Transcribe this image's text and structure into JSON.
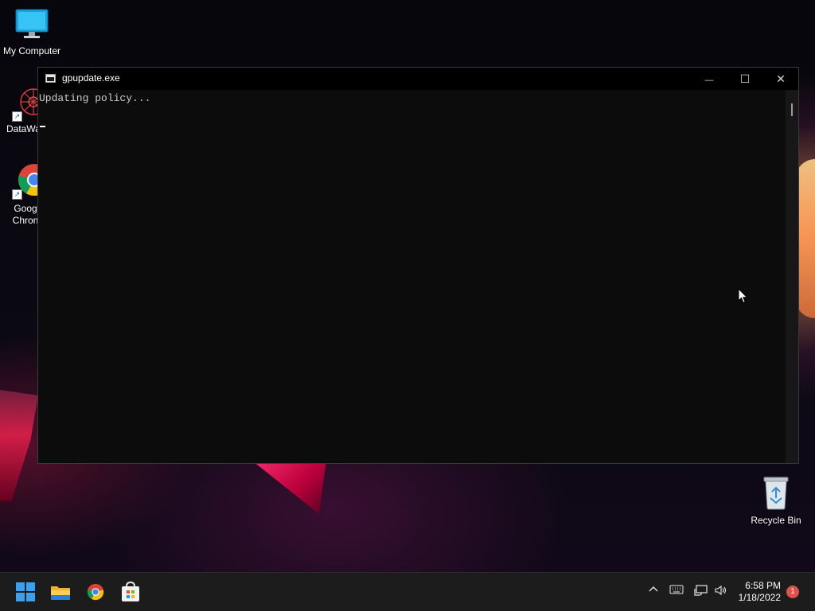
{
  "desktop": {
    "icons": [
      {
        "label": "My Computer"
      },
      {
        "label": "DataWag"
      },
      {
        "label": "Goog Chron"
      }
    ],
    "recycle_bin_label": "Recycle Bin"
  },
  "window": {
    "title": "gpupdate.exe",
    "output_line": "Updating policy...",
    "minimize_glyph": "—",
    "maximize_glyph": "☐",
    "close_glyph": "✕"
  },
  "taskbar": {
    "apps": [
      "start-icon",
      "file-explorer-icon",
      "chrome-icon",
      "microsoft-store-icon"
    ],
    "clock_time": "6:58 PM",
    "clock_date": "1/18/2022",
    "notification_count": "1"
  },
  "colors": {
    "console_bg": "#0c0c0c",
    "console_text": "#cccccc",
    "taskbar_bg": "#1c1c1c",
    "notification_badge": "#e0504a"
  }
}
